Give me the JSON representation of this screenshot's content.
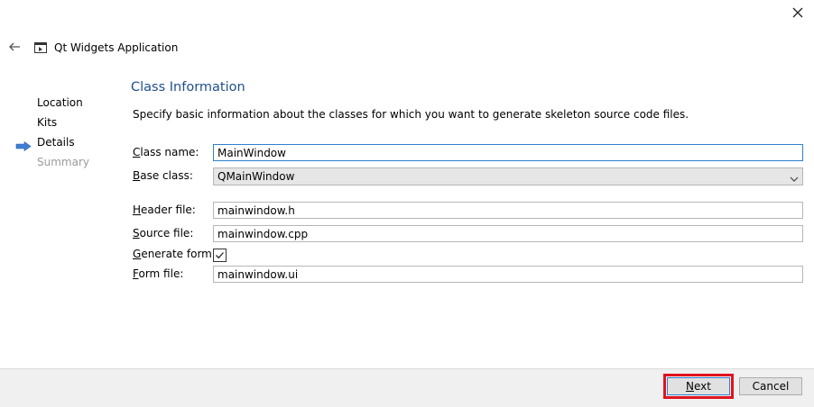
{
  "window": {
    "title": "Qt Widgets Application"
  },
  "steps": [
    {
      "label": "Location",
      "state": "done"
    },
    {
      "label": "Kits",
      "state": "done"
    },
    {
      "label": "Details",
      "state": "current"
    },
    {
      "label": "Summary",
      "state": "pending"
    }
  ],
  "page": {
    "title": "Class Information",
    "description": "Specify basic information about the classes for which you want to generate skeleton source code files."
  },
  "form": {
    "class_name": {
      "mnemonic": "C",
      "rest": "lass name:",
      "value": "MainWindow"
    },
    "base_class": {
      "mnemonic": "B",
      "rest": "ase class:",
      "value": "QMainWindow"
    },
    "header_file": {
      "mnemonic": "H",
      "rest": "eader file:",
      "value": "mainwindow.h"
    },
    "source_file": {
      "mnemonic": "S",
      "rest": "ource file:",
      "value": "mainwindow.cpp"
    },
    "generate_form": {
      "mnemonic": "G",
      "rest": "enerate form:",
      "checked": true
    },
    "form_file": {
      "mnemonic": "F",
      "rest": "orm file:",
      "value": "mainwindow.ui"
    }
  },
  "buttons": {
    "next": {
      "mnemonic": "N",
      "rest": "ext"
    },
    "cancel": "Cancel"
  },
  "colors": {
    "accent": "#2f7fcf",
    "title": "#1f4f8c",
    "highlight": "#e0141e",
    "current_step_arrow": "#3d7fd4"
  }
}
